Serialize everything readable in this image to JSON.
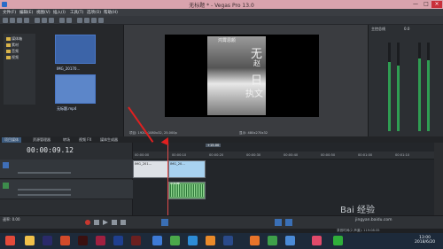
{
  "window": {
    "title": "无标题 * - Vegas Pro 13.0",
    "controls": [
      "—",
      "□",
      "×"
    ]
  },
  "menu": [
    "文件(F)",
    "编辑(E)",
    "视图(V)",
    "插入(I)",
    "工具(T)",
    "选项(O)",
    "帮助(H)"
  ],
  "explorer": {
    "tree_items": [
      "媒体箱",
      "素材",
      "音频",
      "视频"
    ],
    "thumbs": [
      {
        "caption": "IMG_20170..."
      },
      {
        "caption": "无标题.mp4"
      }
    ]
  },
  "preview": {
    "video_texts": [
      "鸿霄恩颜",
      "无",
      "赵",
      "日",
      "执文"
    ],
    "info_left": "项目: 1920x1080x32, 25.000p",
    "info_right": "显示: 480x270x32"
  },
  "mixer": {
    "title": "主控总线",
    "value": "0.0"
  },
  "tabs": [
    "项目媒体",
    "资源管理器",
    "转场",
    "视频 FX",
    "媒体生成器"
  ],
  "timeline": {
    "timecode": "00:00:09.12",
    "ruler_labels": [
      "00:00:00",
      "00:00:10",
      "00:00:20",
      "00:00:30",
      "00:00:40",
      "00:00:50",
      "00:01:00",
      "00:01:10"
    ],
    "video_clip_labels": [
      "IMG_201...",
      "IMG_20..."
    ],
    "audio_clip_label": "无标题",
    "marker": "+15.00"
  },
  "transport_rate": "速率: 0.00",
  "status_text": "录音时间(2 声道): 119:08:35",
  "watermark": {
    "main": "Bai 经验",
    "sub": "jingyan.baidu.com"
  },
  "taskbar": {
    "time": "13:00",
    "date": "2018/6/20"
  },
  "colors": {
    "accent": "#4a78c8",
    "cursor": "#e04b4b",
    "arrow": "#e02020"
  }
}
